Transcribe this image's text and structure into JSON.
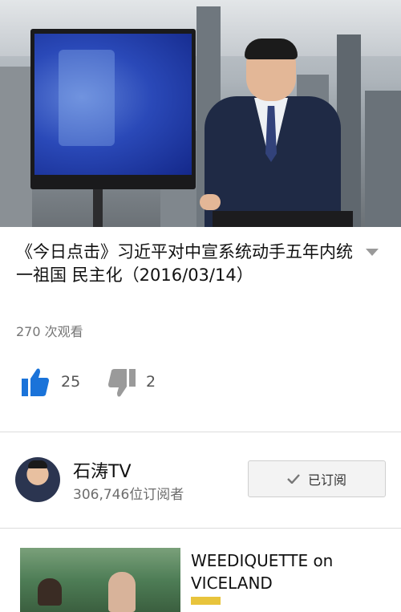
{
  "video": {
    "title": "《今日点击》习近平对中宣系统动手五年内统一祖国 民主化（2016/03/14）",
    "views": "270 次观看"
  },
  "actions": {
    "likes": "25",
    "dislikes": "2"
  },
  "channel": {
    "name": "石涛TV",
    "subscribers": "306,746位订阅者",
    "subscribe_button": "已订阅"
  },
  "up_next": {
    "title": "WEEDIQUETTE on VICELAND"
  },
  "colors": {
    "accent": "#1a73d9",
    "badge": "#e8c43c"
  },
  "icons": {
    "like": "thumbs-up-icon",
    "dislike": "thumbs-down-icon",
    "subscribed": "check-icon",
    "expand": "chevron-down-icon"
  }
}
